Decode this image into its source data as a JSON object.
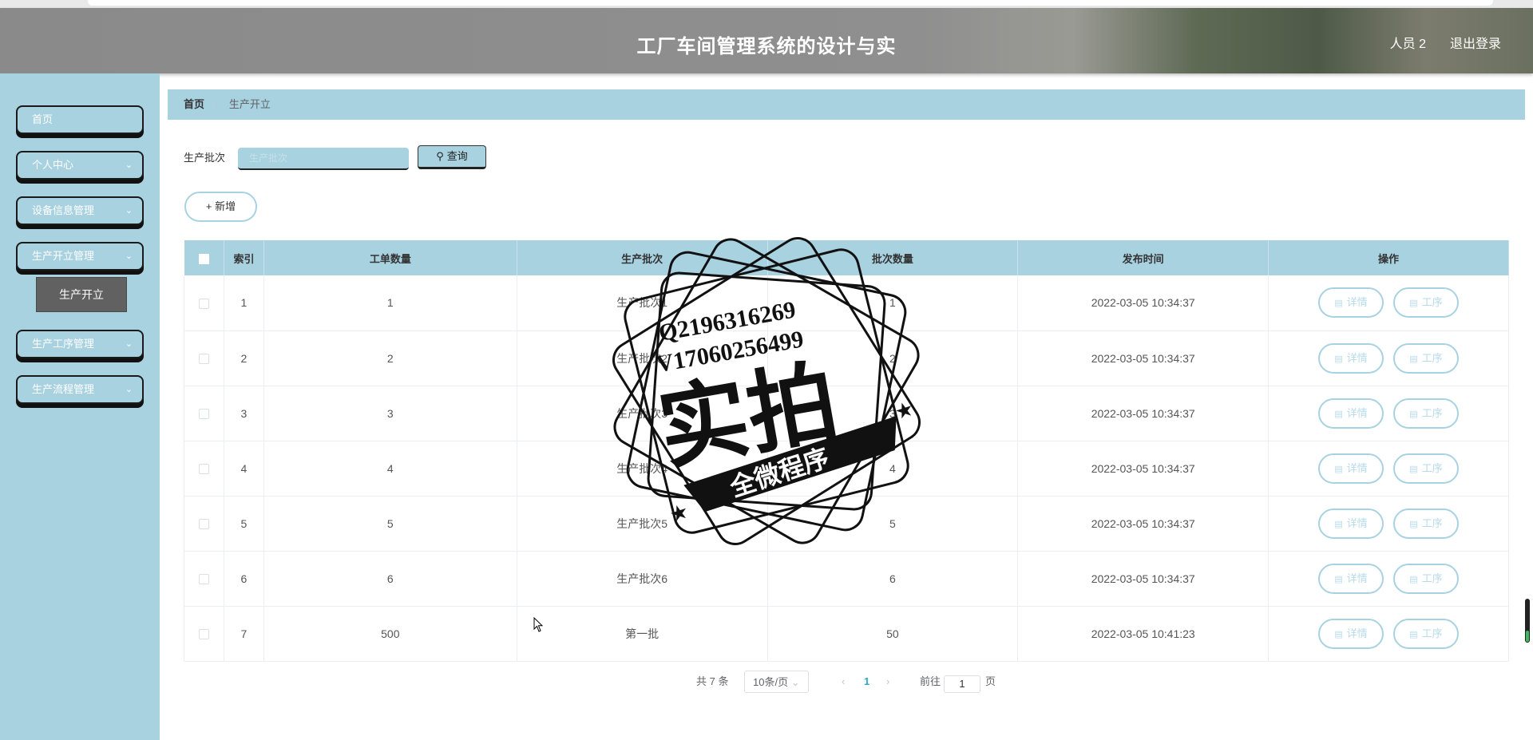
{
  "header": {
    "title": "工厂车间管理系统的设计与实",
    "user": "人员 2",
    "logout": "退出登录"
  },
  "sidebar": {
    "items": [
      {
        "label": "首页",
        "chevron": false
      },
      {
        "label": "个人中心",
        "chevron": true
      },
      {
        "label": "设备信息管理",
        "chevron": true
      },
      {
        "label": "生产开立管理",
        "chevron": true
      },
      {
        "label": "生产工序管理",
        "chevron": true
      },
      {
        "label": "生产流程管理",
        "chevron": true
      }
    ],
    "active_sub": "生产开立"
  },
  "breadcrumb": {
    "home": "首页",
    "sep": "/",
    "current": "生产开立"
  },
  "search": {
    "label": "生产批次",
    "placeholder": "生产批次",
    "value": "",
    "button": "查询"
  },
  "add_button": "新增",
  "table": {
    "columns": [
      "索引",
      "工单数量",
      "生产批次",
      "批次数量",
      "发布时间",
      "操作"
    ],
    "rows": [
      {
        "index": "1",
        "qty": "1",
        "batch": "生产批次1",
        "batch_qty": "1",
        "time": "2022-03-05 10:34:37"
      },
      {
        "index": "2",
        "qty": "2",
        "batch": "生产批次2",
        "batch_qty": "2",
        "time": "2022-03-05 10:34:37"
      },
      {
        "index": "3",
        "qty": "3",
        "batch": "生产批次3",
        "batch_qty": "3",
        "time": "2022-03-05 10:34:37"
      },
      {
        "index": "4",
        "qty": "4",
        "batch": "生产批次4",
        "batch_qty": "4",
        "time": "2022-03-05 10:34:37"
      },
      {
        "index": "5",
        "qty": "5",
        "batch": "生产批次5",
        "batch_qty": "5",
        "time": "2022-03-05 10:34:37"
      },
      {
        "index": "6",
        "qty": "6",
        "batch": "生产批次6",
        "batch_qty": "6",
        "time": "2022-03-05 10:34:37"
      },
      {
        "index": "7",
        "qty": "500",
        "batch": "第一批",
        "batch_qty": "50",
        "time": "2022-03-05 10:41:23"
      }
    ],
    "actions": [
      "详情",
      "工序"
    ]
  },
  "pagination": {
    "total": "共 7 条",
    "page_size": "10条/页",
    "current": "1",
    "goto_label": "前往",
    "goto_value": "1",
    "page_suffix": "页"
  },
  "watermark": {
    "line1": "Q2196316269",
    "line2": "V17060256499",
    "main": "实拍",
    "banner": "全微程序"
  },
  "colors": {
    "accent": "#a9d2e1",
    "active_sub": "#616161"
  }
}
